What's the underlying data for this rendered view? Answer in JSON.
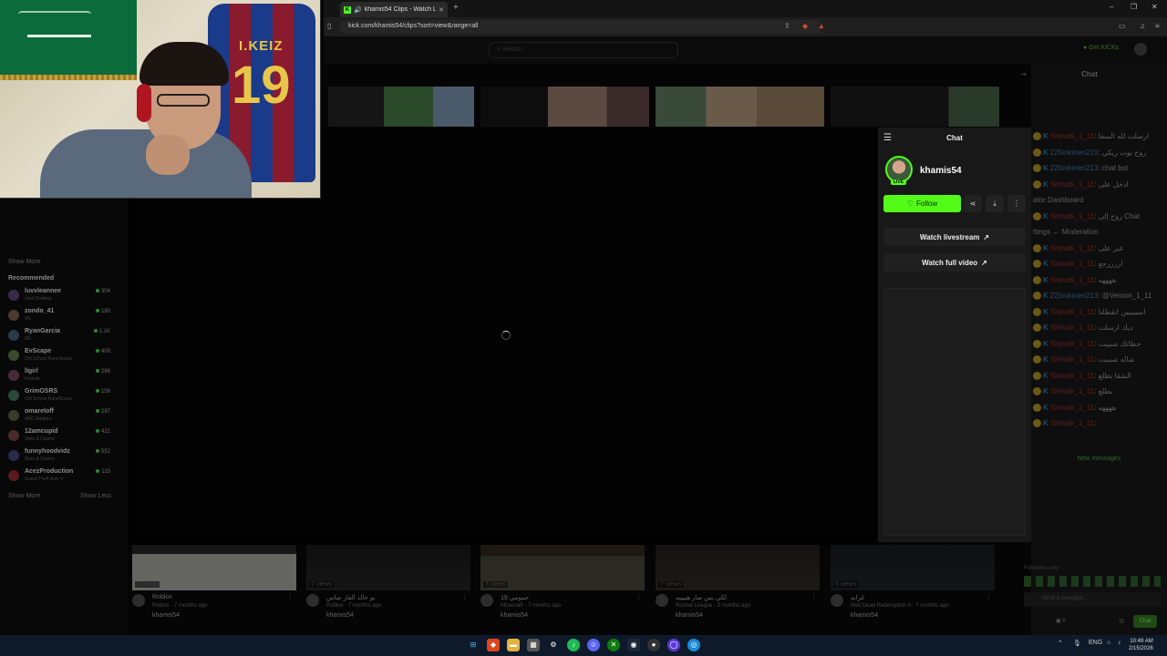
{
  "browser": {
    "tab_title": "khamis54 Clips - Watch Live",
    "url": "kick.com/khamis54/clips?sort=view&range=all",
    "window_controls": [
      "–",
      "❐",
      "✕"
    ]
  },
  "webcam": {
    "jersey_name": "I.KEIZ",
    "jersey_number": "19"
  },
  "site": {
    "search_placeholder": "Search",
    "get_kicks": "Get KICKs",
    "background_chat_title": "Chat"
  },
  "sidebar": {
    "show_more_top": "Show More",
    "recommended_title": "Recommended",
    "recommended": [
      {
        "name": "luvvleannee",
        "game": "Just Chatting",
        "count": "304"
      },
      {
        "name": "zondo_41",
        "game": "IRL",
        "count": "180"
      },
      {
        "name": "RyanGarcia",
        "game": "IRL",
        "count": "1.1K"
      },
      {
        "name": "EvScape",
        "game": "Old School RuneScape",
        "count": "400"
      },
      {
        "name": "llgirl",
        "game": "Fortnite",
        "count": "286"
      },
      {
        "name": "GrimOSRS",
        "game": "Old School RuneScape",
        "count": "156"
      },
      {
        "name": "omareloff",
        "game": "ARC Raiders",
        "count": "297"
      },
      {
        "name": "12amcupid",
        "game": "Slots & Casino",
        "count": "421"
      },
      {
        "name": "funnyhoodvidz",
        "game": "Slots & Casino",
        "count": "552"
      },
      {
        "name": "AcezProduction",
        "game": "Grand Theft Auto V",
        "count": "115"
      }
    ],
    "show_more": "Show More",
    "show_less": "Show Less"
  },
  "clips": [
    {
      "views": "7 views",
      "title": "Roblox",
      "sub": "Roblox · 7 months ago",
      "channel": "khamis54"
    },
    {
      "views": "7 views",
      "title": "بو خالد الفاز صاس",
      "sub": "Roblox · 7 months ago",
      "channel": "khamis54"
    },
    {
      "views": "7 views",
      "title": "19 حمومي",
      "sub": "Minecraft · 7 months ago",
      "channel": "khamis54"
    },
    {
      "views": "7 views",
      "title": "لكي بس صار هييييه",
      "sub": "Rocket League · 9 months ago",
      "channel": "khamis54"
    },
    {
      "views": "6 views",
      "title": "غرابه",
      "sub": "Red Dead Redemption II · 7 months ago",
      "channel": "khamis54"
    }
  ],
  "clip_panel": {
    "title": "Chat",
    "channel": "khamis54",
    "live_badge": "LIVE",
    "follow_label": "Follow",
    "watch_livestream": "Watch livestream",
    "watch_full_video": "Watch full video"
  },
  "right_chat": {
    "title": "Chat",
    "messages": [
      {
        "user": "Shinobi_1_11",
        "text": "ارسلت لله السقا"
      },
      {
        "user": "225mkinen210",
        "text": "روح بوت ريكي"
      },
      {
        "user": "225mkinen213",
        "text": "chat bot"
      },
      {
        "user": "Shinobi_1_11",
        "text": "ادخل على"
      },
      {
        "user": "",
        "text": "ator Dashboard"
      },
      {
        "user": "Shinobi_1_11",
        "text": "روح إلى Chat"
      },
      {
        "user": "",
        "text": "ttings ← Moderation"
      },
      {
        "user": "Shinobi_1_11",
        "text": "غير على"
      },
      {
        "user": "Shinobi_1_11",
        "text": "اررررجع"
      },
      {
        "user": "Shinobi_1_11",
        "text": "ههههه"
      },
      {
        "user": "225mkinen213",
        "text": "@Venom_1_11"
      },
      {
        "user": "Shinobi_1_11",
        "text": "اسيييبين انقطلنا"
      },
      {
        "user": "Shinobi_1_11",
        "text": "ديك ارسلت"
      },
      {
        "user": "Shinobi_1_11",
        "text": "حطاتك شبيبت"
      },
      {
        "user": "Shinobi_1_11",
        "text": "شاله شبيبت"
      },
      {
        "user": "Shinobi_1_11",
        "text": "الشقا بطلع"
      },
      {
        "user": "Shinobi_1_11",
        "text": "بطلع"
      },
      {
        "user": "Shinobi_1_11",
        "text": "ههههه"
      },
      {
        "user": "Shinobi_1_11",
        "text": ""
      }
    ],
    "new_messages": "New messages",
    "followers_only": "Followers only",
    "input_placeholder": "Send a message...",
    "points": "0",
    "send_label": "Chat"
  },
  "taskbar": {
    "lang": "ENG",
    "time": "10:49 AM",
    "date": "2/15/2026"
  },
  "colors": {
    "kick_green": "#53fc18",
    "panel_bg": "#181818"
  }
}
